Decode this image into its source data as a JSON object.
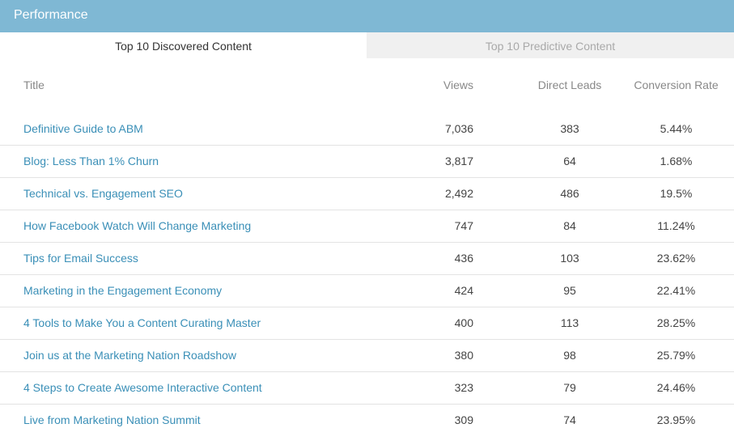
{
  "header": {
    "title": "Performance"
  },
  "tabs": [
    {
      "label": "Top 10 Discovered Content",
      "active": true
    },
    {
      "label": "Top 10 Predictive Content",
      "active": false
    }
  ],
  "table": {
    "columns": [
      "Title",
      "Views",
      "Direct Leads",
      "Conversion Rate"
    ],
    "rows": [
      {
        "title": "Definitive Guide to ABM",
        "views": "7,036",
        "leads": "383",
        "conversion": "5.44%"
      },
      {
        "title": "Blog: Less Than 1% Churn",
        "views": "3,817",
        "leads": "64",
        "conversion": "1.68%"
      },
      {
        "title": "Technical vs. Engagement SEO",
        "views": "2,492",
        "leads": "486",
        "conversion": "19.5%"
      },
      {
        "title": "How Facebook Watch Will Change Marketing",
        "views": "747",
        "leads": "84",
        "conversion": "11.24%"
      },
      {
        "title": "Tips for Email Success",
        "views": "436",
        "leads": "103",
        "conversion": "23.62%"
      },
      {
        "title": "Marketing in the Engagement Economy",
        "views": "424",
        "leads": "95",
        "conversion": "22.41%"
      },
      {
        "title": "4 Tools to Make You a Content Curating Master",
        "views": "400",
        "leads": "113",
        "conversion": "28.25%"
      },
      {
        "title": "Join us at the Marketing Nation Roadshow",
        "views": "380",
        "leads": "98",
        "conversion": "25.79%"
      },
      {
        "title": "4 Steps to Create Awesome Interactive Content",
        "views": "323",
        "leads": "79",
        "conversion": "24.46%"
      },
      {
        "title": "Live from Marketing Nation Summit",
        "views": "309",
        "leads": "74",
        "conversion": "23.95%"
      }
    ]
  },
  "colors": {
    "header_bg": "#7fb8d4",
    "link": "#3a8fb7",
    "inactive_tab_bg": "#f0f0f0"
  }
}
